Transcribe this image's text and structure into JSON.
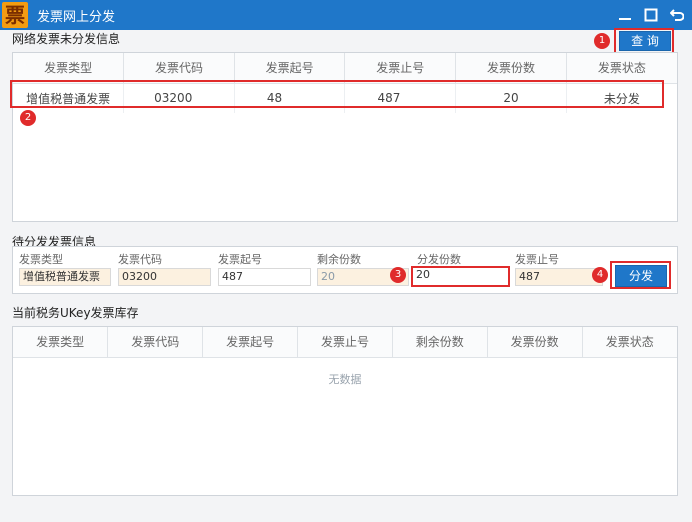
{
  "window": {
    "title": "发票网上分发",
    "app_icon_char": "票"
  },
  "undistributed": {
    "section_title": "网络发票未分发信息",
    "query_button": "查 询",
    "columns": [
      "发票类型",
      "发票代码",
      "发票起号",
      "发票止号",
      "发票份数",
      "发票状态"
    ],
    "rows": [
      {
        "type": "增值税普通发票",
        "code": "03200",
        "start": "48",
        "end": "487",
        "count": "20",
        "status": "未分发"
      }
    ]
  },
  "pending": {
    "section_title": "待分发发票信息",
    "labels": {
      "type": "发票类型",
      "code": "发票代码",
      "start": "发票起号",
      "remaining": "剩余份数",
      "dist_count": "分发份数",
      "end": "发票止号"
    },
    "values": {
      "type": "增值税普通发票",
      "code": "03200",
      "start": "487",
      "remaining": "20",
      "dist_count": "20",
      "end": "487"
    },
    "distribute_button": "分发"
  },
  "ukey": {
    "section_title": "当前税务UKey发票库存",
    "columns": [
      "发票类型",
      "发票代码",
      "发票起号",
      "发票止号",
      "剩余份数",
      "发票份数",
      "发票状态"
    ],
    "empty_text": "无数据"
  },
  "badges": [
    "1",
    "2",
    "3",
    "4"
  ],
  "colors": {
    "titlebar": "#1f77c9",
    "highlight": "#e02b2b",
    "readonly_field": "#fcf1e0"
  },
  "icons": {
    "minimize": "minimize-icon",
    "maximize": "maximize-icon",
    "restore": "restore-icon"
  }
}
